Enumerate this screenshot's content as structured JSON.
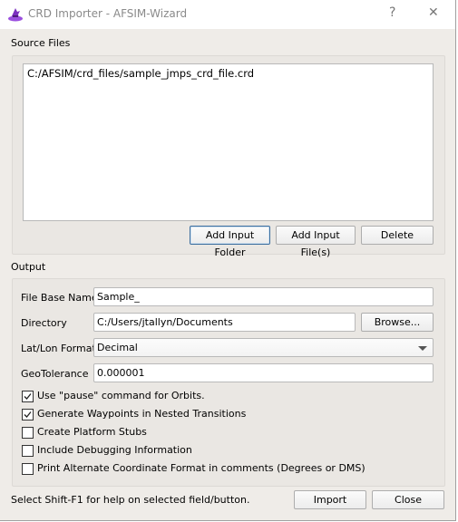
{
  "window": {
    "title": "CRD Importer - AFSIM-Wizard",
    "help_label": "?",
    "close_label": "✕",
    "icon": "wizard-hat-icon"
  },
  "source": {
    "section_label": "Source Files",
    "files": [
      "C:/AFSIM/crd_files/sample_jmps_crd_file.crd"
    ],
    "add_folder_label": "Add Input Folder",
    "add_files_label": "Add Input File(s)",
    "delete_label": "Delete"
  },
  "output": {
    "section_label": "Output",
    "file_base_name": {
      "label": "File Base Name",
      "value": "Sample_"
    },
    "directory": {
      "label": "Directory",
      "value": "C:/Users/jtallyn/Documents",
      "browse_label": "Browse..."
    },
    "latlon_format": {
      "label": "Lat/Lon Format",
      "value": "Decimal"
    },
    "geotolerance": {
      "label": "GeoTolerance",
      "value": "0.000001"
    },
    "options": [
      {
        "label": "Use \"pause\" command for Orbits.",
        "checked": true
      },
      {
        "label": "Generate Waypoints in Nested Transitions",
        "checked": true
      },
      {
        "label": "Create Platform Stubs",
        "checked": false
      },
      {
        "label": "Include Debugging Information",
        "checked": false
      },
      {
        "label": "Print Alternate Coordinate Format in comments (Degrees or DMS)",
        "checked": false
      }
    ]
  },
  "footer": {
    "help_text": "Select Shift-F1 for help on selected field/button.",
    "import_label": "Import",
    "close_label": "Close"
  },
  "colors": {
    "accent_icon": "#7b2fbf",
    "focus_border": "#3c6e9e"
  }
}
